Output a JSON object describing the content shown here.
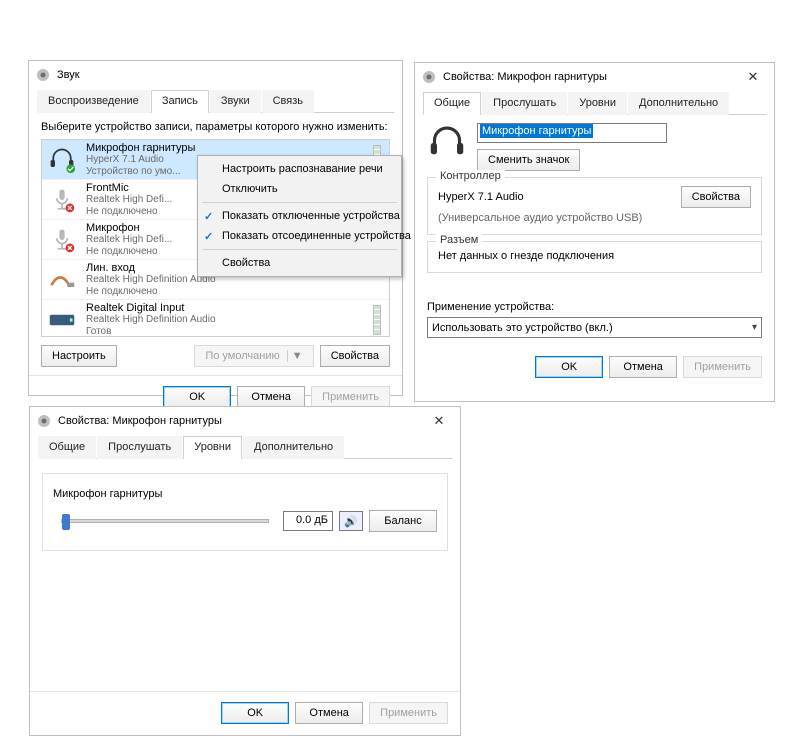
{
  "sound_window": {
    "title": "Звук",
    "tabs": [
      "Воспроизведение",
      "Запись",
      "Звуки",
      "Связь"
    ],
    "active_tab": 1,
    "prompt": "Выберите устройство записи, параметры которого нужно изменить:",
    "devices": [
      {
        "name": "Микрофон гарнитуры",
        "driver": "HyperX 7.1 Audio",
        "status": "Устройство по умо..."
      },
      {
        "name": "FrontMic",
        "driver": "Realtek High Defi...",
        "status": "Не подключено"
      },
      {
        "name": "Микрофон",
        "driver": "Realtek High Defi...",
        "status": "Не подключено"
      },
      {
        "name": "Лин. вход",
        "driver": "Realtek High Definition Audio",
        "status": "Не подключено"
      },
      {
        "name": "Realtek Digital Input",
        "driver": "Realtek High Definition Audio",
        "status": "Готов"
      }
    ],
    "btn_configure": "Настроить",
    "btn_default": "По умолчанию",
    "btn_properties": "Свойства",
    "footer": {
      "ok": "OK",
      "cancel": "Отмена",
      "apply": "Применить"
    }
  },
  "context_menu": {
    "items": [
      {
        "label": "Настроить распознавание речи",
        "checked": false
      },
      {
        "label": "Отключить",
        "checked": false
      }
    ],
    "items2": [
      {
        "label": "Показать отключенные устройства",
        "checked": true
      },
      {
        "label": "Показать отсоединенные устройства",
        "checked": true
      }
    ],
    "items3": [
      {
        "label": "Свойства",
        "checked": false
      }
    ]
  },
  "props_general": {
    "title": "Свойства: Микрофон гарнитуры",
    "tabs": [
      "Общие",
      "Прослушать",
      "Уровни",
      "Дополнительно"
    ],
    "active_tab": 0,
    "name_value": "Микрофон гарнитуры",
    "change_icon": "Сменить значок",
    "controller_box": "Контроллер",
    "controller_name": "HyperX 7.1 Audio",
    "controller_sub": "(Универсальное аудио устройство USB)",
    "controller_props_btn": "Свойства",
    "jack_box": "Разъем",
    "jack_text": "Нет данных о гнезде подключения",
    "usage_label": "Применение устройства:",
    "usage_value": "Использовать это устройство (вкл.)",
    "footer": {
      "ok": "OK",
      "cancel": "Отмена",
      "apply": "Применить"
    }
  },
  "props_levels": {
    "title": "Свойства: Микрофон гарнитуры",
    "tabs": [
      "Общие",
      "Прослушать",
      "Уровни",
      "Дополнительно"
    ],
    "active_tab": 2,
    "section_label": "Микрофон гарнитуры",
    "level_db": "0.0 дБ",
    "balance_btn": "Баланс",
    "footer": {
      "ok": "OK",
      "cancel": "Отмена",
      "apply": "Применить"
    }
  },
  "glyphs": {
    "close": "✕",
    "speaker": "🔊",
    "caret": "▾",
    "split_caret": "▼"
  }
}
